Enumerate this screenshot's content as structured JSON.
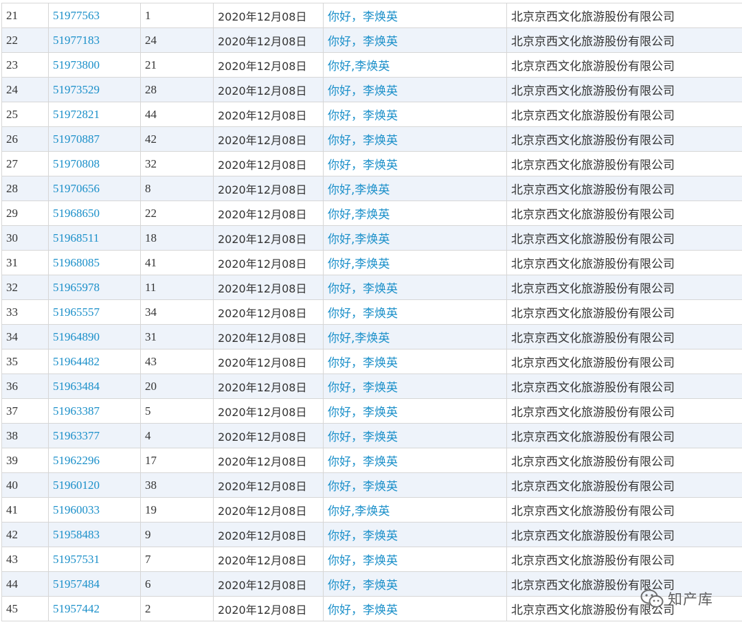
{
  "table": {
    "rows": [
      {
        "index": "21",
        "reg_no": "51977563",
        "class": "1",
        "date": "2020年12月08日",
        "name": "你好，李焕英",
        "applicant": "北京京西文化旅游股份有限公司"
      },
      {
        "index": "22",
        "reg_no": "51977183",
        "class": "24",
        "date": "2020年12月08日",
        "name": "你好，李焕英",
        "applicant": "北京京西文化旅游股份有限公司"
      },
      {
        "index": "23",
        "reg_no": "51973800",
        "class": "21",
        "date": "2020年12月08日",
        "name": "你好,李焕英",
        "applicant": "北京京西文化旅游股份有限公司"
      },
      {
        "index": "24",
        "reg_no": "51973529",
        "class": "28",
        "date": "2020年12月08日",
        "name": "你好，李焕英",
        "applicant": "北京京西文化旅游股份有限公司"
      },
      {
        "index": "25",
        "reg_no": "51972821",
        "class": "44",
        "date": "2020年12月08日",
        "name": "你好，李焕英",
        "applicant": "北京京西文化旅游股份有限公司"
      },
      {
        "index": "26",
        "reg_no": "51970887",
        "class": "42",
        "date": "2020年12月08日",
        "name": "你好，李焕英",
        "applicant": "北京京西文化旅游股份有限公司"
      },
      {
        "index": "27",
        "reg_no": "51970808",
        "class": "32",
        "date": "2020年12月08日",
        "name": "你好，李焕英",
        "applicant": "北京京西文化旅游股份有限公司"
      },
      {
        "index": "28",
        "reg_no": "51970656",
        "class": "8",
        "date": "2020年12月08日",
        "name": "你好,李焕英",
        "applicant": "北京京西文化旅游股份有限公司"
      },
      {
        "index": "29",
        "reg_no": "51968650",
        "class": "22",
        "date": "2020年12月08日",
        "name": "你好,李焕英",
        "applicant": "北京京西文化旅游股份有限公司"
      },
      {
        "index": "30",
        "reg_no": "51968511",
        "class": "18",
        "date": "2020年12月08日",
        "name": "你好,李焕英",
        "applicant": "北京京西文化旅游股份有限公司"
      },
      {
        "index": "31",
        "reg_no": "51968085",
        "class": "41",
        "date": "2020年12月08日",
        "name": "你好,李焕英",
        "applicant": "北京京西文化旅游股份有限公司"
      },
      {
        "index": "32",
        "reg_no": "51965978",
        "class": "11",
        "date": "2020年12月08日",
        "name": "你好，李焕英",
        "applicant": "北京京西文化旅游股份有限公司"
      },
      {
        "index": "33",
        "reg_no": "51965557",
        "class": "34",
        "date": "2020年12月08日",
        "name": "你好，李焕英",
        "applicant": "北京京西文化旅游股份有限公司"
      },
      {
        "index": "34",
        "reg_no": "51964890",
        "class": "31",
        "date": "2020年12月08日",
        "name": "你好,李焕英",
        "applicant": "北京京西文化旅游股份有限公司"
      },
      {
        "index": "35",
        "reg_no": "51964482",
        "class": "43",
        "date": "2020年12月08日",
        "name": "你好，李焕英",
        "applicant": "北京京西文化旅游股份有限公司"
      },
      {
        "index": "36",
        "reg_no": "51963484",
        "class": "20",
        "date": "2020年12月08日",
        "name": "你好，李焕英",
        "applicant": "北京京西文化旅游股份有限公司"
      },
      {
        "index": "37",
        "reg_no": "51963387",
        "class": "5",
        "date": "2020年12月08日",
        "name": "你好，李焕英",
        "applicant": "北京京西文化旅游股份有限公司"
      },
      {
        "index": "38",
        "reg_no": "51963377",
        "class": "4",
        "date": "2020年12月08日",
        "name": "你好，李焕英",
        "applicant": "北京京西文化旅游股份有限公司"
      },
      {
        "index": "39",
        "reg_no": "51962296",
        "class": "17",
        "date": "2020年12月08日",
        "name": "你好，李焕英",
        "applicant": "北京京西文化旅游股份有限公司"
      },
      {
        "index": "40",
        "reg_no": "51960120",
        "class": "38",
        "date": "2020年12月08日",
        "name": "你好，李焕英",
        "applicant": "北京京西文化旅游股份有限公司"
      },
      {
        "index": "41",
        "reg_no": "51960033",
        "class": "19",
        "date": "2020年12月08日",
        "name": "你好,李焕英",
        "applicant": "北京京西文化旅游股份有限公司"
      },
      {
        "index": "42",
        "reg_no": "51958483",
        "class": "9",
        "date": "2020年12月08日",
        "name": "你好，李焕英",
        "applicant": "北京京西文化旅游股份有限公司"
      },
      {
        "index": "43",
        "reg_no": "51957531",
        "class": "7",
        "date": "2020年12月08日",
        "name": "你好，李焕英",
        "applicant": "北京京西文化旅游股份有限公司"
      },
      {
        "index": "44",
        "reg_no": "51957484",
        "class": "6",
        "date": "2020年12月08日",
        "name": "你好，李焕英",
        "applicant": "北京京西文化旅游股份有限公司"
      },
      {
        "index": "45",
        "reg_no": "51957442",
        "class": "2",
        "date": "2020年12月08日",
        "name": "你好，李焕英",
        "applicant": "北京京西文化旅游股份有限公司"
      }
    ]
  },
  "watermark": {
    "text": "知产库",
    "icon": "wechat-icon"
  },
  "colors": {
    "link": "#1a8fc9",
    "stripe": "#eef3fa",
    "border": "#d6d6d6",
    "text": "#333333"
  }
}
